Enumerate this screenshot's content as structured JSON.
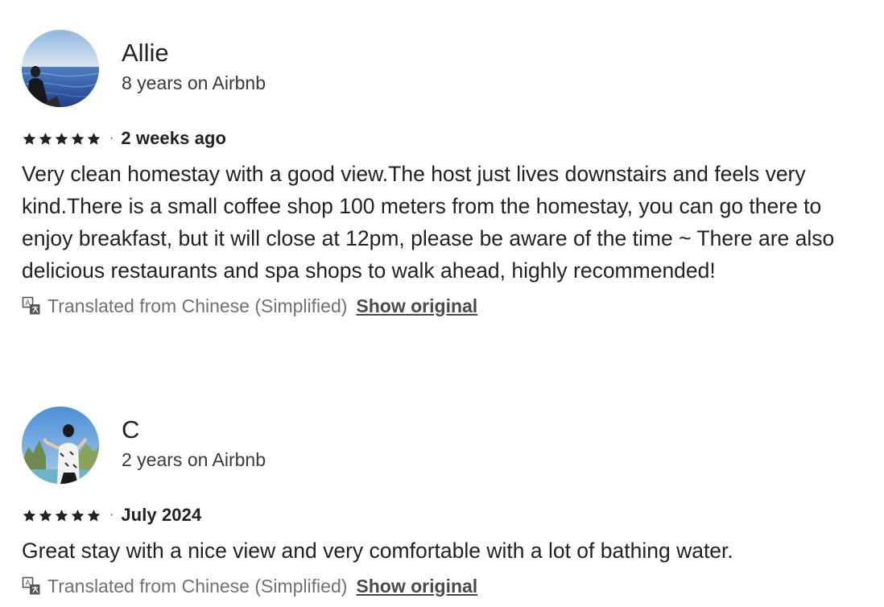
{
  "reviews": [
    {
      "name": "Allie",
      "tenure": "8 years on Airbnb",
      "rating": 5,
      "date": "2 weeks ago",
      "text": "Very clean homestay with a good view.The host just lives downstairs and feels very kind.There is a small coffee shop 100 meters from the homestay, you can go there to enjoy breakfast, but it will close at 12pm, please be aware of the time ~ There are also delicious restaurants and spa shops to walk ahead, highly recommended!",
      "translation_note": "Translated from Chinese (Simplified)",
      "show_original_label": "Show original",
      "avatar_icon": "sea-photo-avatar"
    },
    {
      "name": "C",
      "tenure": "2 years on Airbnb",
      "rating": 5,
      "date": "July 2024",
      "text": "Great stay with a nice view and very comfortable with a lot of bathing water.",
      "translation_note": "Translated from Chinese (Simplified)",
      "show_original_label": "Show original",
      "avatar_icon": "beach-photo-avatar"
    }
  ],
  "separator": "·",
  "colors": {
    "text": "#222222",
    "muted": "#717171",
    "star": "#222222"
  }
}
